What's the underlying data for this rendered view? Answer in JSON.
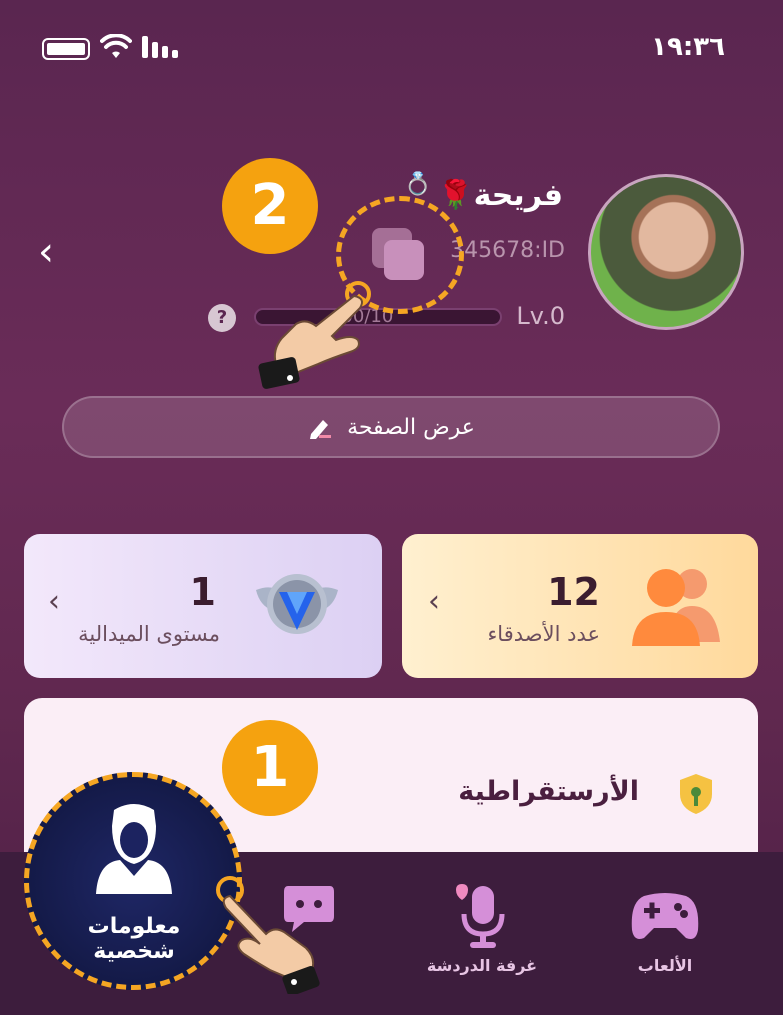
{
  "status_bar": {
    "time": "١٩:٣٦"
  },
  "profile": {
    "username": "فريحة",
    "user_id": "345678:ID",
    "level": "Lv.0",
    "xp": "400/10",
    "help": "?"
  },
  "view_page_button": {
    "label": "عرض الصفحة"
  },
  "stats": {
    "friends": {
      "value": "12",
      "label": "عدد الأصدقاء"
    },
    "medal": {
      "value": "1",
      "label": "مستوى الميدالية"
    }
  },
  "aristocracy": {
    "title": "الأرستقراطية"
  },
  "steps": {
    "step1": "1",
    "step2": "2"
  },
  "nav": {
    "games": "الألعاب",
    "chat_room": "غرفة الدردشة",
    "profile": "معلومات شخصية"
  },
  "icons": {
    "battery": "battery-icon",
    "wifi": "wifi-icon",
    "signal": "signal-icon",
    "back": "chevron-left-icon",
    "copy": "copy-icon",
    "edit": "pencil-icon",
    "friends": "friends-icon",
    "medal": "medal-icon",
    "shield": "shield-icon",
    "games": "gamepad-icon",
    "chat": "microphone-icon",
    "profile": "person-icon"
  },
  "colors": {
    "accent": "#f5a623",
    "background": "#5a2650",
    "nav": "#3d1d3d"
  }
}
